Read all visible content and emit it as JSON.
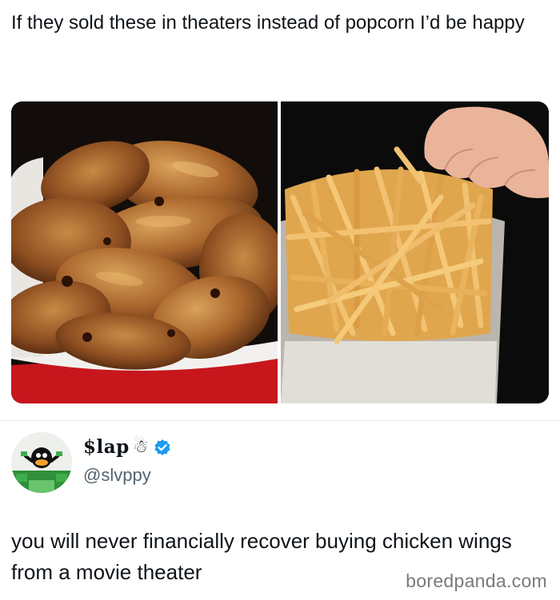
{
  "post": {
    "text": "If they sold these in theaters instead of popcorn I’d be happy"
  },
  "images": [
    {
      "subject": "bucket of chicken wings",
      "icon": "chicken-wings-photo"
    },
    {
      "subject": "bucket of french fries",
      "icon": "french-fries-photo"
    }
  ],
  "reply": {
    "display_name": "$lap",
    "name_emoji": "☃",
    "handle": "@slvppy",
    "verified": true,
    "text": "you will never financially recover buying chicken wings from a movie theater"
  },
  "watermark": "boredpanda.com",
  "colors": {
    "verified_badge": "#1d9bf0",
    "handle": "#536471",
    "watermark": "#7a7a7a"
  }
}
